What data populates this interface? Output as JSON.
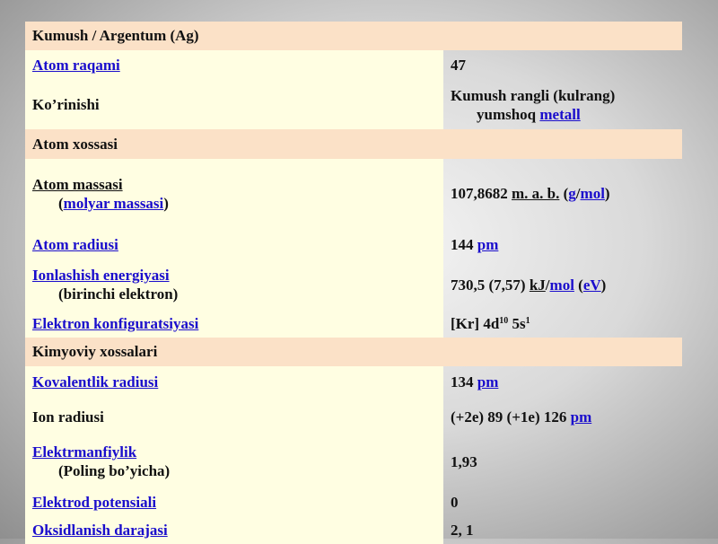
{
  "table": {
    "title": "Kumush / Argentum (Ag)",
    "atom_number": {
      "label": "Atom raqami",
      "value": "47"
    },
    "appearance": {
      "label": "Ko’rinishi",
      "value_line1": "Kumush rangli (kulrang)",
      "value_line2_text": "yumshoq ",
      "value_line2_link": "metall"
    },
    "section_atom": "Atom xossasi",
    "atom_mass": {
      "label": "Atom massasi",
      "sub_open": "(",
      "sub_link": "molyar massasi",
      "sub_close": ")",
      "value": "107,8682 ",
      "unit1": "m. a. b.",
      "paren_open": " (",
      "unit2": "g",
      "slash": "/",
      "unit3": "mol",
      "paren_close": ")"
    },
    "atom_radius": {
      "label": "Atom radiusi",
      "value": "144 ",
      "unit": "pm"
    },
    "ionization": {
      "label": "Ionlashish energiyasi",
      "sub": "(birinchi elektron)",
      "value": "730,5 (7,57) ",
      "unit1": "kJ",
      "slash": "/",
      "unit2": "mol",
      "paren_open": " (",
      "unit3": "eV",
      "paren_close": ")"
    },
    "electron_config": {
      "label": "Elektron konfiguratsiyasi",
      "value_main": "[Kr] 4d",
      "sup1": "10",
      "value_mid": " 5s",
      "sup2": "1"
    },
    "section_chem": "Kimyoviy xossalari",
    "covalent_radius": {
      "label": "Kovalentlik radiusi",
      "value": "134 ",
      "unit": "pm"
    },
    "ion_radius": {
      "label": "Ion radiusi",
      "value": "(+2e) 89 (+1e) 126 ",
      "unit": "pm"
    },
    "electronegativity": {
      "label": "Elektrmanfiylik",
      "sub": "(Poling bo’yicha)",
      "value": "1,93"
    },
    "electrode_potential": {
      "label": "Elektrod potensiali",
      "value": "0"
    },
    "oxidation_state": {
      "label": "Oksidlanish darajasi",
      "value": "2, 1"
    }
  }
}
